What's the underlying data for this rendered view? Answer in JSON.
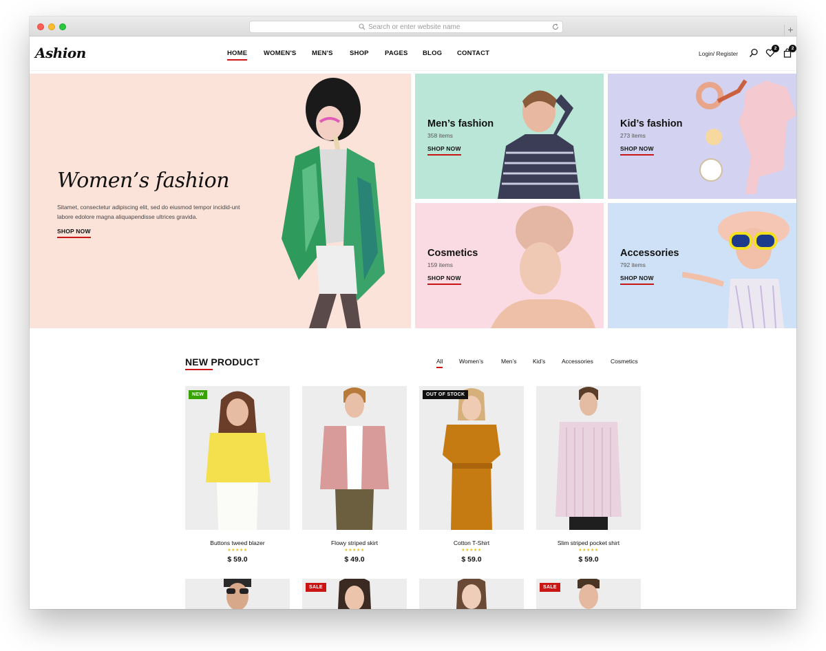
{
  "browser": {
    "url_placeholder": "Search or enter website name"
  },
  "header": {
    "logo": "Ashion",
    "nav": [
      {
        "label": "HOME",
        "active": true
      },
      {
        "label": "WOMEN'S",
        "active": false
      },
      {
        "label": "MEN'S",
        "active": false
      },
      {
        "label": "SHOP",
        "active": false
      },
      {
        "label": "PAGES",
        "active": false
      },
      {
        "label": "BLOG",
        "active": false
      },
      {
        "label": "CONTACT",
        "active": false
      }
    ],
    "login": "Login/ Register",
    "icons": [
      "search-icon",
      "heart-icon",
      "bag-icon"
    ],
    "wishlist_count": "2",
    "cart_count": "2"
  },
  "hero": {
    "main": {
      "title": "Women’s fashion",
      "text": "Sitamet, consectetur adipiscing elit, sed do eiusmod tempor incidid-unt labore edolore magna aliquapendisse ultrices gravida.",
      "cta": "SHOP NOW"
    },
    "tiles": [
      {
        "title": "Men’s fashion",
        "count": "358 items",
        "cta": "SHOP NOW"
      },
      {
        "title": "Kid’s fashion",
        "count": "273 items",
        "cta": "SHOP NOW"
      },
      {
        "title": "Cosmetics",
        "count": "159 items",
        "cta": "SHOP NOW"
      },
      {
        "title": "Accessories",
        "count": "792 items",
        "cta": "SHOP NOW"
      }
    ]
  },
  "new_product": {
    "title": "NEW PRODUCT",
    "filters": [
      {
        "label": "All",
        "active": true
      },
      {
        "label": "Women’s",
        "active": false
      },
      {
        "label": "Men’s",
        "active": false
      },
      {
        "label": "Kid’s",
        "active": false
      },
      {
        "label": "Accessories",
        "active": false
      },
      {
        "label": "Cosmetics",
        "active": false
      }
    ],
    "products": [
      {
        "name": "Buttons tweed blazer",
        "rating": "★★★★★",
        "price": "$ 59.0",
        "tag": "NEW"
      },
      {
        "name": "Flowy striped skirt",
        "rating": "★★★★★",
        "price": "$ 49.0",
        "tag": ""
      },
      {
        "name": "Cotton T-Shirt",
        "rating": "★★★★★",
        "price": "$ 59.0",
        "tag": "OUT OF STOCK"
      },
      {
        "name": "Slim striped pocket shirt",
        "rating": "★★★★★",
        "price": "$ 59.0",
        "tag": ""
      }
    ],
    "second_row_tags": [
      "",
      "SALE",
      "",
      "SALE"
    ]
  },
  "colors": {
    "accent": "#ca1515",
    "hero_main_bg": "#fbe3da",
    "mens_bg": "#b9e6d6",
    "kids_bg": "#d3d2f0",
    "cosmetics_bg": "#fadae3",
    "accessories_bg": "#cfe1f6",
    "tag_new": "#36a300"
  }
}
